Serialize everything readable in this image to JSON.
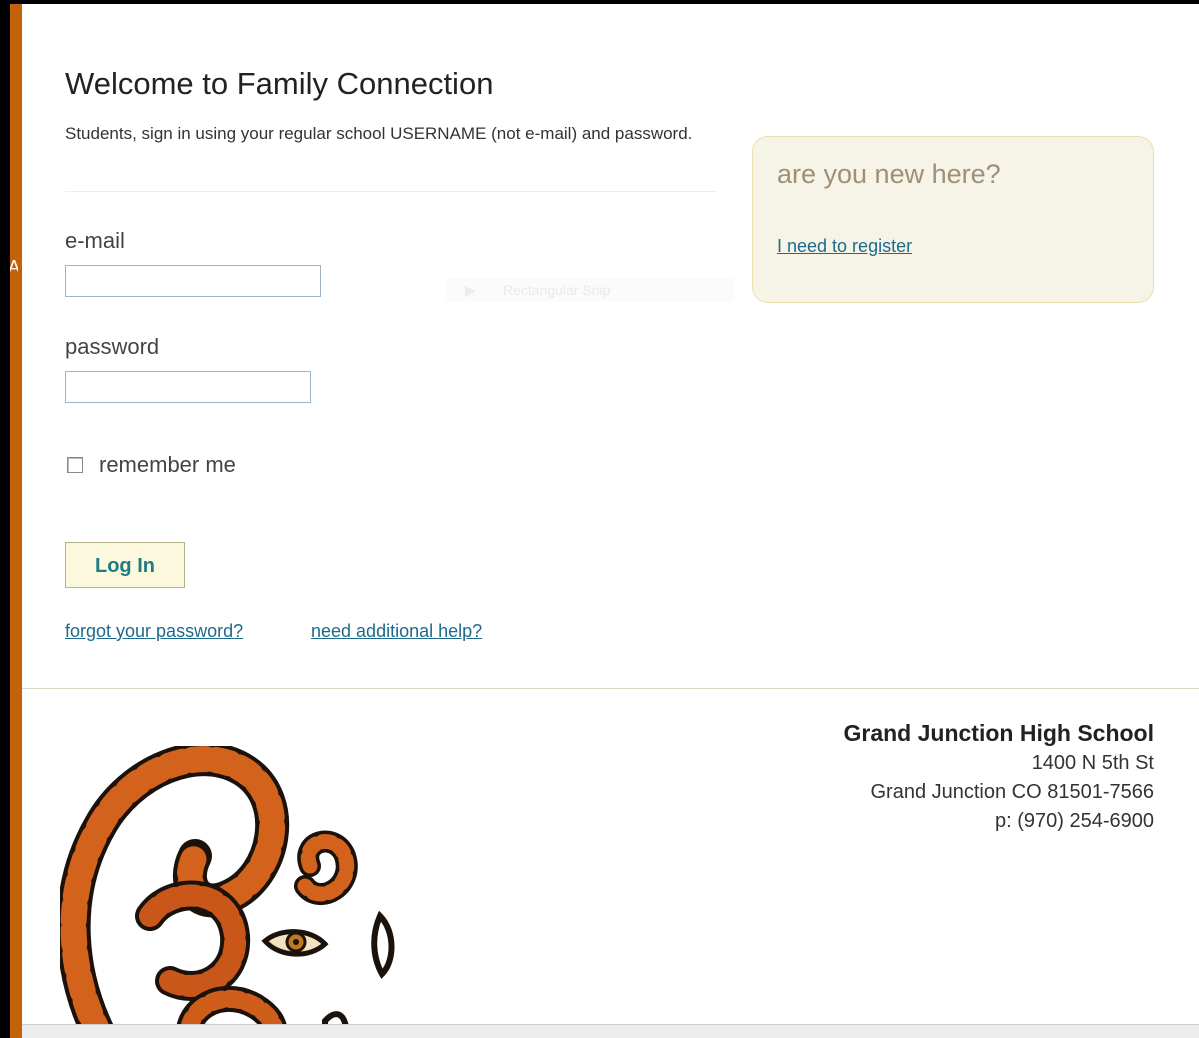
{
  "page": {
    "title": "Welcome to Family Connection",
    "intro": "Students, sign in using your regular school USERNAME (not e-mail) and password."
  },
  "login": {
    "email_label": "e-mail",
    "email_value": "",
    "password_label": "password",
    "password_value": "",
    "remember_label": "remember me",
    "remember_checked": false,
    "login_button": "Log In",
    "forgot_link": "forgot your password?",
    "help_link": "need additional help?"
  },
  "new_user": {
    "title": "are you new here?",
    "register_link": "I need to register"
  },
  "ghost_overlay": {
    "text": "Rectangular Snip"
  },
  "school": {
    "name": "Grand Junction High School",
    "street": "1400 N 5th St",
    "city_line": "Grand Junction CO 81501-7566",
    "phone": "p: (970) 254-6900"
  },
  "colors": {
    "accent_bar": "#c4620c",
    "link": "#1d6a8c",
    "button_bg": "#fbf8dd",
    "newbox_bg": "#f6f4e6"
  },
  "icons": {
    "logo": "tiger-stripe-logo",
    "checkbox": "checkbox-unchecked"
  }
}
